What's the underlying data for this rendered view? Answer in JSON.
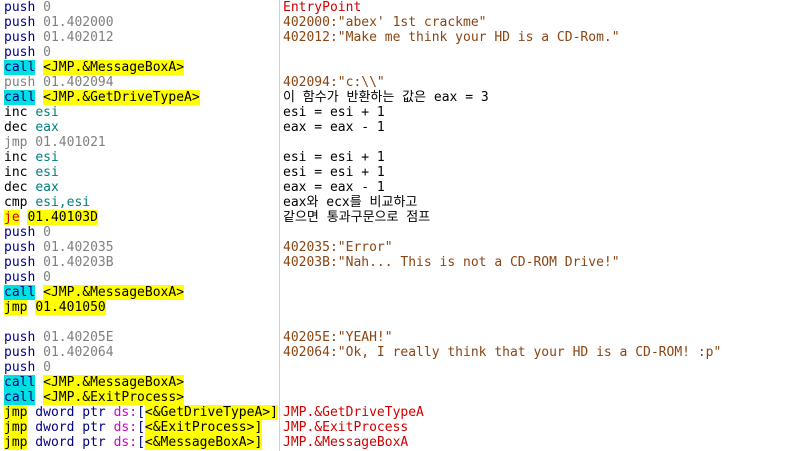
{
  "lines": [
    {
      "asm": [
        {
          "t": "push",
          "c": "k-mn"
        },
        {
          "t": " 0",
          "c": "k-op"
        }
      ],
      "comment": "EntryPoint",
      "comment_class": "k-cmt-red"
    },
    {
      "asm": [
        {
          "t": "push",
          "c": "k-mn"
        },
        {
          "t": " 01.402000",
          "c": "k-op"
        }
      ],
      "comment": "402000:\"abex' 1st crackme\"",
      "comment_class": "k-cmt-str"
    },
    {
      "asm": [
        {
          "t": "push",
          "c": "k-mn"
        },
        {
          "t": " 01.402012",
          "c": "k-op"
        }
      ],
      "comment": "402012:\"Make me think your HD is a CD-Rom.\"",
      "comment_class": "k-cmt-str"
    },
    {
      "asm": [
        {
          "t": "push",
          "c": "k-mn"
        },
        {
          "t": " 0",
          "c": "k-op"
        }
      ],
      "comment": "",
      "comment_class": "k-cmt-black"
    },
    {
      "asm": [
        {
          "t": "call",
          "c": "k-call"
        },
        {
          "t": " ",
          "c": "k-plain"
        },
        {
          "t": "<JMP.&MessageBoxA>",
          "c": "k-hl"
        }
      ],
      "comment": "",
      "comment_class": "k-cmt-black"
    },
    {
      "asm": [
        {
          "t": "push",
          "c": "k-mn-g"
        },
        {
          "t": " 01.402094",
          "c": "k-op"
        }
      ],
      "comment": "402094:\"c:\\\\\"",
      "comment_class": "k-cmt-str"
    },
    {
      "asm": [
        {
          "t": "call",
          "c": "k-call"
        },
        {
          "t": " ",
          "c": "k-plain"
        },
        {
          "t": "<JMP.&GetDriveTypeA>",
          "c": "k-hl"
        }
      ],
      "comment": "이 함수가 반환하는 값은 eax = 3",
      "comment_class": "k-cmt-black"
    },
    {
      "asm": [
        {
          "t": "inc",
          "c": "k-plain"
        },
        {
          "t": " ",
          "c": "k-plain"
        },
        {
          "t": "esi",
          "c": "k-reg"
        }
      ],
      "comment": "esi = esi + 1",
      "comment_class": "k-cmt-black"
    },
    {
      "asm": [
        {
          "t": "dec",
          "c": "k-plain"
        },
        {
          "t": " ",
          "c": "k-plain"
        },
        {
          "t": "eax",
          "c": "k-reg"
        }
      ],
      "comment": "eax = eax - 1",
      "comment_class": "k-cmt-black"
    },
    {
      "asm": [
        {
          "t": "jmp",
          "c": "k-mn-g"
        },
        {
          "t": " 01.401021",
          "c": "k-op"
        }
      ],
      "comment": "",
      "comment_class": "k-cmt-black"
    },
    {
      "asm": [
        {
          "t": "inc",
          "c": "k-plain"
        },
        {
          "t": " ",
          "c": "k-plain"
        },
        {
          "t": "esi",
          "c": "k-reg"
        }
      ],
      "comment": "esi = esi + 1",
      "comment_class": "k-cmt-black"
    },
    {
      "asm": [
        {
          "t": "inc",
          "c": "k-plain"
        },
        {
          "t": " ",
          "c": "k-plain"
        },
        {
          "t": "esi",
          "c": "k-reg"
        }
      ],
      "comment": "esi = esi + 1",
      "comment_class": "k-cmt-black"
    },
    {
      "asm": [
        {
          "t": "dec",
          "c": "k-plain"
        },
        {
          "t": " ",
          "c": "k-plain"
        },
        {
          "t": "eax",
          "c": "k-reg"
        }
      ],
      "comment": "eax = eax - 1",
      "comment_class": "k-cmt-black"
    },
    {
      "asm": [
        {
          "t": "cmp",
          "c": "k-plain"
        },
        {
          "t": " ",
          "c": "k-plain"
        },
        {
          "t": "esi,esi",
          "c": "k-reg"
        }
      ],
      "comment": "eax와 ecx를 비교하고",
      "comment_class": "k-cmt-black"
    },
    {
      "asm": [
        {
          "t": "je",
          "c": "k-jcc"
        },
        {
          "t": " ",
          "c": "k-plain"
        },
        {
          "t": "01.40103D",
          "c": "k-hl"
        }
      ],
      "comment": "같으면 통과구문으로 점프",
      "comment_class": "k-cmt-black"
    },
    {
      "asm": [
        {
          "t": "push",
          "c": "k-mn"
        },
        {
          "t": " 0",
          "c": "k-op"
        }
      ],
      "comment": "",
      "comment_class": "k-cmt-black"
    },
    {
      "asm": [
        {
          "t": "push",
          "c": "k-mn"
        },
        {
          "t": " 01.402035",
          "c": "k-op"
        }
      ],
      "comment": "402035:\"Error\"",
      "comment_class": "k-cmt-str"
    },
    {
      "asm": [
        {
          "t": "push",
          "c": "k-mn"
        },
        {
          "t": " 01.40203B",
          "c": "k-op"
        }
      ],
      "comment": "40203B:\"Nah... This is not a CD-ROM Drive!\"",
      "comment_class": "k-cmt-str"
    },
    {
      "asm": [
        {
          "t": "push",
          "c": "k-mn"
        },
        {
          "t": " 0",
          "c": "k-op"
        }
      ],
      "comment": "",
      "comment_class": "k-cmt-black"
    },
    {
      "asm": [
        {
          "t": "call",
          "c": "k-call"
        },
        {
          "t": " ",
          "c": "k-plain"
        },
        {
          "t": "<JMP.&MessageBoxA>",
          "c": "k-hl"
        }
      ],
      "comment": "",
      "comment_class": "k-cmt-black"
    },
    {
      "asm": [
        {
          "t": "jmp",
          "c": "k-hl"
        },
        {
          "t": " ",
          "c": "k-plain"
        },
        {
          "t": "01.401050",
          "c": "k-hl"
        }
      ],
      "comment": "",
      "comment_class": "k-cmt-black"
    },
    {
      "asm": [
        {
          "t": "",
          "c": "k-plain"
        }
      ],
      "comment": "",
      "comment_class": "k-cmt-black"
    },
    {
      "asm": [
        {
          "t": "push",
          "c": "k-mn"
        },
        {
          "t": " 01.40205E",
          "c": "k-op"
        }
      ],
      "comment": "40205E:\"YEAH!\"",
      "comment_class": "k-cmt-str"
    },
    {
      "asm": [
        {
          "t": "push",
          "c": "k-mn"
        },
        {
          "t": " 01.402064",
          "c": "k-op"
        }
      ],
      "comment": "402064:\"Ok, I really think that your HD is a CD-ROM! :p\"",
      "comment_class": "k-cmt-str"
    },
    {
      "asm": [
        {
          "t": "push",
          "c": "k-mn"
        },
        {
          "t": " 0",
          "c": "k-op"
        }
      ],
      "comment": "",
      "comment_class": "k-cmt-black"
    },
    {
      "asm": [
        {
          "t": "call",
          "c": "k-call"
        },
        {
          "t": " ",
          "c": "k-plain"
        },
        {
          "t": "<JMP.&MessageBoxA>",
          "c": "k-hl"
        }
      ],
      "comment": "",
      "comment_class": "k-cmt-black"
    },
    {
      "asm": [
        {
          "t": "call",
          "c": "k-call"
        },
        {
          "t": " ",
          "c": "k-plain"
        },
        {
          "t": "<JMP.&ExitProcess>",
          "c": "k-hl"
        }
      ],
      "comment": "",
      "comment_class": "k-cmt-black"
    },
    {
      "asm": [
        {
          "t": "jmp",
          "c": "k-hl"
        },
        {
          "t": " dword ptr ",
          "c": "k-jmpn"
        },
        {
          "t": "ds:",
          "c": "k-seg"
        },
        {
          "t": "[",
          "c": "k-jmpn"
        },
        {
          "t": "<&GetDriveTypeA>]",
          "c": "k-hl"
        }
      ],
      "comment": "JMP.&GetDriveTypeA",
      "comment_class": "k-cmt-red"
    },
    {
      "asm": [
        {
          "t": "jmp",
          "c": "k-hl"
        },
        {
          "t": " dword ptr ",
          "c": "k-jmpn"
        },
        {
          "t": "ds:",
          "c": "k-seg"
        },
        {
          "t": "[",
          "c": "k-jmpn"
        },
        {
          "t": "<&ExitProcess>]",
          "c": "k-hl"
        }
      ],
      "comment": "JMP.&ExitProcess",
      "comment_class": "k-cmt-red"
    },
    {
      "asm": [
        {
          "t": "jmp",
          "c": "k-hl"
        },
        {
          "t": " dword ptr ",
          "c": "k-jmpn"
        },
        {
          "t": "ds:",
          "c": "k-seg"
        },
        {
          "t": "[",
          "c": "k-jmpn"
        },
        {
          "t": "<&MessageBoxA>]",
          "c": "k-hl"
        }
      ],
      "comment": "JMP.&MessageBoxA",
      "comment_class": "k-cmt-red"
    }
  ]
}
